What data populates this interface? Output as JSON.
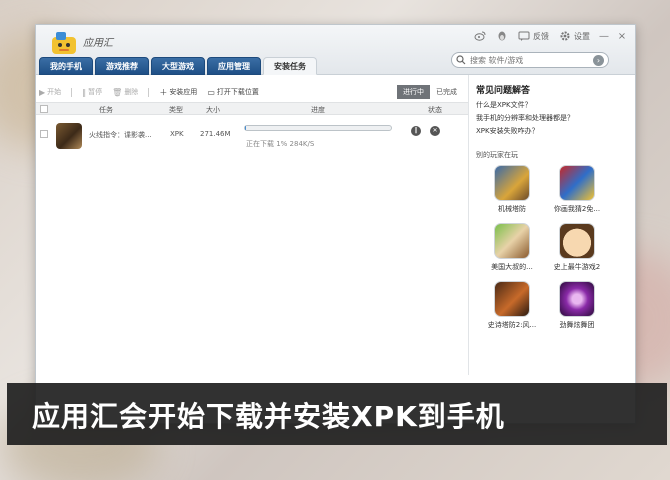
{
  "app": {
    "title": "应用汇"
  },
  "header": {
    "feedback_label": "反馈",
    "settings_label": "设置",
    "minimize": "—",
    "close": "×"
  },
  "tabs": [
    {
      "label": "我的手机"
    },
    {
      "label": "游戏推荐"
    },
    {
      "label": "大型游戏"
    },
    {
      "label": "应用管理"
    },
    {
      "label": "安装任务",
      "active": true
    }
  ],
  "search": {
    "placeholder": "搜索 软件/游戏"
  },
  "toolbar": {
    "start": "开始",
    "pause": "暂停",
    "delete": "删除",
    "install": "安装应用",
    "open_folder": "打开下载位置"
  },
  "subtabs": {
    "in_progress": "进行中",
    "done": "已完成"
  },
  "table": {
    "headers": {
      "task": "任务",
      "type": "类型",
      "size": "大小",
      "progress": "进度",
      "status": "状态"
    },
    "rows": [
      {
        "name": "火线指令：谍影袭...",
        "type": "XPK",
        "size": "271.46M",
        "progress_pct": 1,
        "status_text": "正在下载 1% 284K/S"
      }
    ]
  },
  "faq": {
    "title": "常见问题解答",
    "links": [
      "什么是XPK文件？",
      "我手机的分辨率和处理器都是？",
      "XPK安装失败咋办？"
    ]
  },
  "others": {
    "title": "别的玩家在玩",
    "apps": [
      {
        "label": "机械塔防"
      },
      {
        "label": "你画我猜2免..."
      },
      {
        "label": "美国大叔的..."
      },
      {
        "label": "史上最牛游戏2"
      },
      {
        "label": "史诗塔防2:风..."
      },
      {
        "label": "劲舞炫舞团"
      }
    ]
  },
  "caption": "应用汇会开始下载并安装XPK到手机"
}
